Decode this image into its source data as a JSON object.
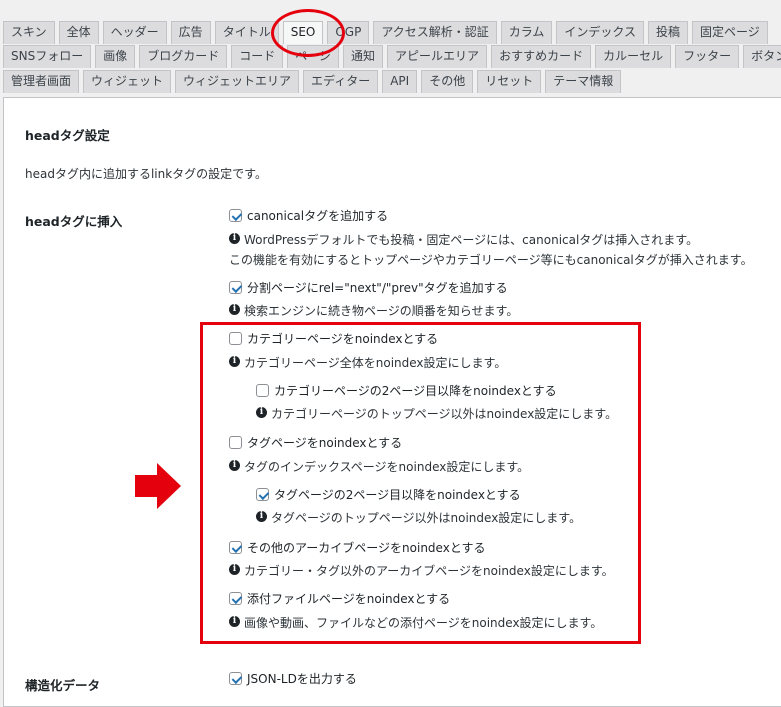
{
  "tabs": {
    "row1": [
      "スキン",
      "全体",
      "ヘッダー",
      "広告",
      "タイトル",
      "SEO",
      "OGP",
      "アクセス解析・認証",
      "カラム",
      "インデックス",
      "投稿",
      "固定ページ"
    ],
    "row2": [
      "SNSフォロー",
      "画像",
      "ブログカード",
      "コード",
      "ページ",
      "通知",
      "アピールエリア",
      "おすすめカード",
      "カルーセル",
      "フッター",
      "ボタン"
    ],
    "row3": [
      "管理者画面",
      "ウィジェット",
      "ウィジェットエリア",
      "エディター",
      "API",
      "その他",
      "リセット",
      "テーマ情報"
    ],
    "active": "SEO"
  },
  "section": {
    "title": "headタグ設定",
    "description": "headタグ内に追加するlinkタグの設定です。"
  },
  "head_insert": {
    "label": "headタグに挿入",
    "options": [
      {
        "label": "canonicalタグを追加する",
        "checked": true,
        "notes": [
          "WordPressデフォルトでも投稿・固定ページには、canonicalタグは挿入されます。",
          "この機能を有効にするとトップページやカテゴリーページ等にもcanonicalタグが挿入されます。"
        ]
      },
      {
        "label": "分割ページにrel=\"next\"/\"prev\"タグを追加する",
        "checked": true,
        "notes": [
          "検索エンジンに続き物ページの順番を知らせます。"
        ]
      },
      {
        "label": "カテゴリーページをnoindexとする",
        "checked": false,
        "notes": [
          "カテゴリーページ全体をnoindex設定にします。"
        ]
      },
      {
        "label": "カテゴリーページの2ページ目以降をnoindexとする",
        "checked": false,
        "notes": [
          "カテゴリーページのトップページ以外はnoindex設定にします。"
        ]
      },
      {
        "label": "タグページをnoindexとする",
        "checked": false,
        "notes": [
          "タグのインデックスページをnoindex設定にします。"
        ]
      },
      {
        "label": "タグページの2ページ目以降をnoindexとする",
        "checked": true,
        "notes": [
          "タグページのトップページ以外はnoindex設定にします。"
        ]
      },
      {
        "label": "その他のアーカイブページをnoindexとする",
        "checked": true,
        "notes": [
          "カテゴリー・タグ以外のアーカイブページをnoindex設定にします。"
        ]
      },
      {
        "label": "添付ファイルページをnoindexとする",
        "checked": true,
        "notes": [
          "画像や動画、ファイルなどの添付ページをnoindex設定にします。"
        ]
      }
    ]
  },
  "structured": {
    "label": "構造化データ",
    "option": {
      "label": "JSON-LDを出力する",
      "checked": true
    }
  },
  "colors": {
    "accent": "#2271b1",
    "highlight": "#e5000d"
  },
  "icons": {
    "info": "info-icon",
    "arrow": "arrow-right-icon"
  }
}
